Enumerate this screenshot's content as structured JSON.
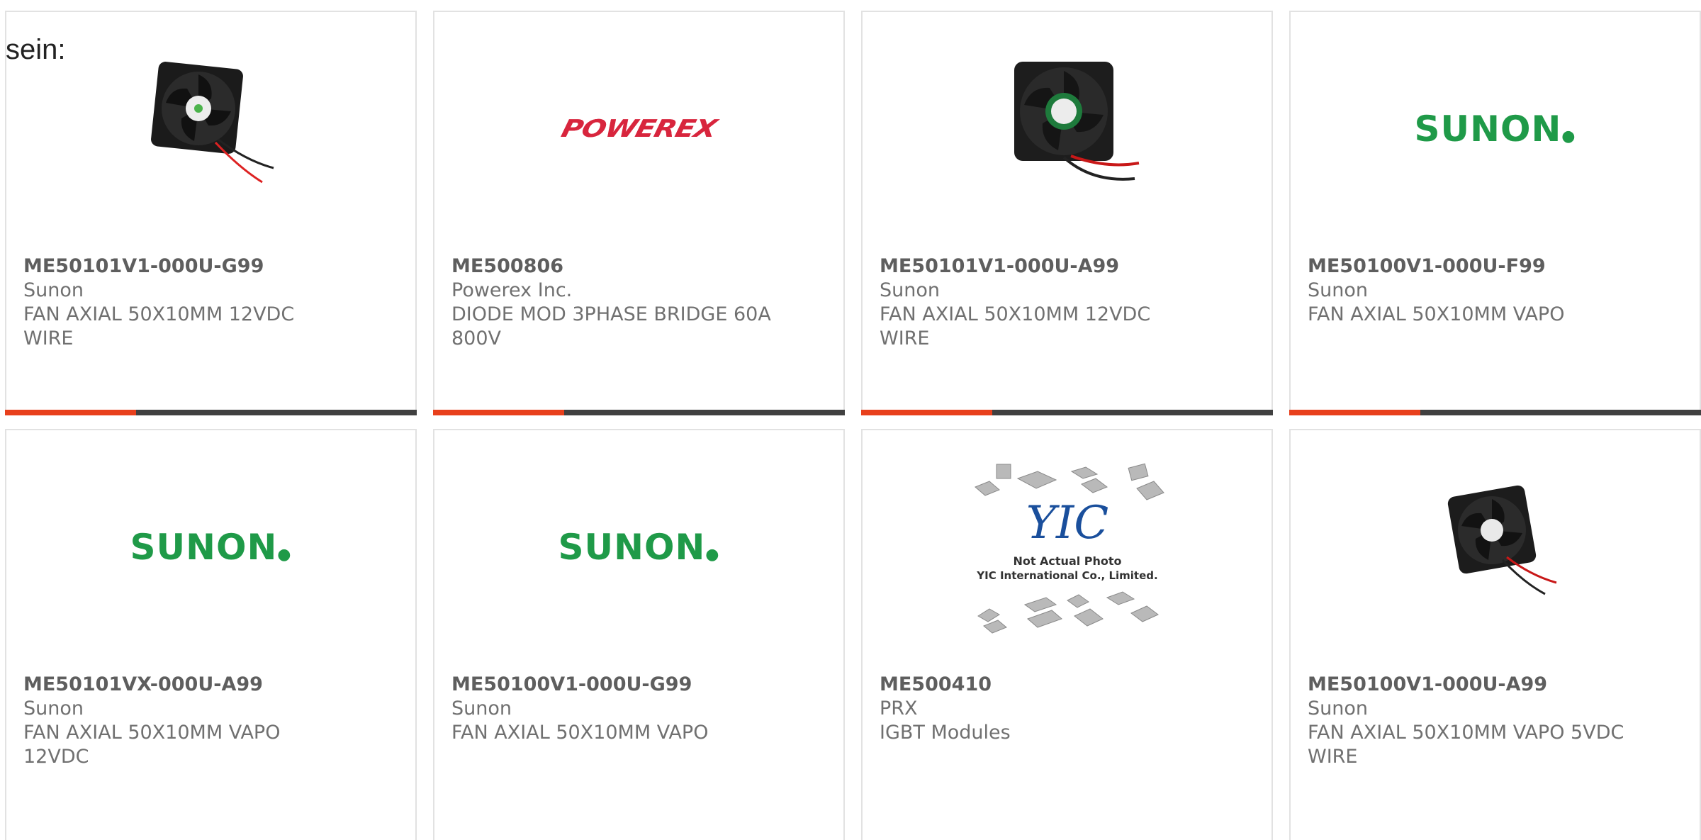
{
  "intro_text": "sein:",
  "theme": {
    "accent": "#e8401c",
    "bar_dark": "#404040",
    "sunon_green": "#1f9a48",
    "powerex_red": "#d8253d"
  },
  "products": [
    {
      "part_number": "ME50101V1-000U-G99",
      "manufacturer": "Sunon",
      "description_1": "FAN AXIAL 50X10MM 12VDC",
      "description_2": "WIRE",
      "image": "fan-photo"
    },
    {
      "part_number": "ME500806",
      "manufacturer": "Powerex Inc.",
      "description_1": "DIODE MOD 3PHASE BRIDGE 60A",
      "description_2": "800V",
      "image": "powerex-logo",
      "logo_text": "POWEREX"
    },
    {
      "part_number": "ME50101V1-000U-A99",
      "manufacturer": "Sunon",
      "description_1": "FAN AXIAL 50X10MM 12VDC",
      "description_2": "WIRE",
      "image": "fan-photo"
    },
    {
      "part_number": "ME50100V1-000U-F99",
      "manufacturer": "Sunon",
      "description_1": "FAN AXIAL 50X10MM VAPO",
      "description_2": "",
      "image": "sunon-logo",
      "logo_text": "SUNON"
    },
    {
      "part_number": "ME50101VX-000U-A99",
      "manufacturer": "Sunon",
      "description_1": "FAN AXIAL 50X10MM VAPO",
      "description_2": "12VDC",
      "image": "sunon-logo",
      "logo_text": "SUNON"
    },
    {
      "part_number": "ME50100V1-000U-G99",
      "manufacturer": "Sunon",
      "description_1": "FAN AXIAL 50X10MM VAPO",
      "description_2": "",
      "image": "sunon-logo",
      "logo_text": "SUNON"
    },
    {
      "part_number": "ME500410",
      "manufacturer": "PRX",
      "description_1": "IGBT Modules",
      "description_2": "",
      "image": "yic-placeholder",
      "logo_text": "YIC",
      "photo_note_1": "Not Actual Photo",
      "photo_note_2": "YIC International Co., Limited."
    },
    {
      "part_number": "ME50100V1-000U-A99",
      "manufacturer": "Sunon",
      "description_1": "FAN AXIAL 50X10MM VAPO 5VDC",
      "description_2": "WIRE",
      "image": "fan-photo"
    }
  ]
}
